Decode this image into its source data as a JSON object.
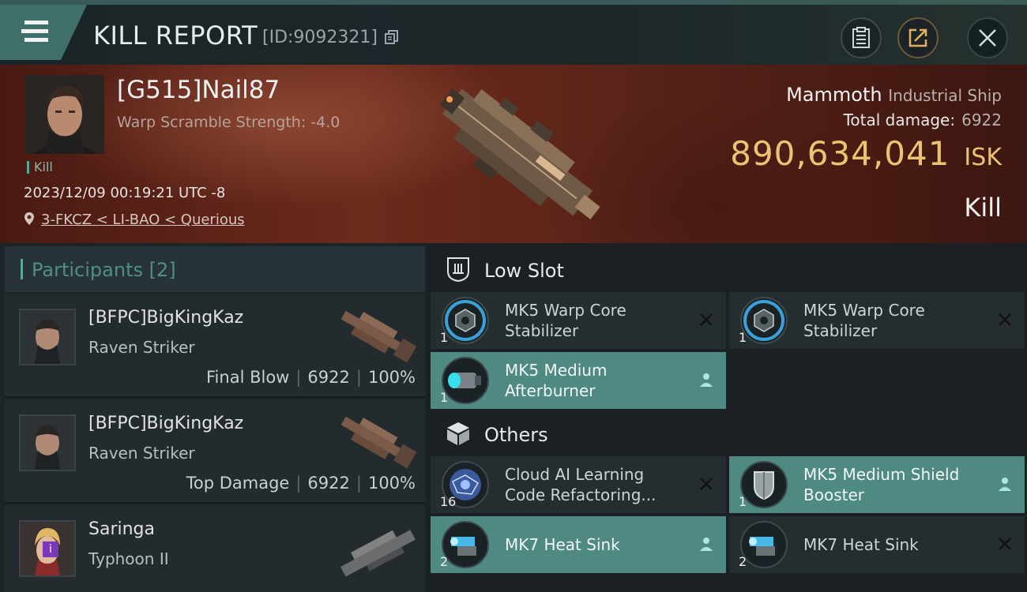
{
  "header": {
    "title": "KILL REPORT",
    "report_id": "[ID:9092321]",
    "icons": [
      "menu-icon",
      "copy-icon",
      "clipboard-icon",
      "share-icon",
      "close-icon"
    ]
  },
  "victim": {
    "name": "[G515]Nail87",
    "warp_scramble": "Warp Scramble Strength: -4.0",
    "tag": "Kill",
    "timestamp": "2023/12/09 00:19:21 UTC -8",
    "location": "3-FKCZ < LI-BAO < Querious"
  },
  "ship": {
    "name": "Mammoth",
    "class": "Industrial Ship",
    "total_damage_label": "Total damage:",
    "total_damage": "6922",
    "isk_value": "890,634,041",
    "isk_unit": "ISK",
    "result": "Kill"
  },
  "participants": {
    "title": "Participants [2]",
    "items": [
      {
        "name": "[BFPC]BigKingKaz",
        "ship": "Raven Striker",
        "role": "Final Blow",
        "damage": "6922",
        "percent": "100%"
      },
      {
        "name": "[BFPC]BigKingKaz",
        "ship": "Raven Striker",
        "role": "Top Damage",
        "damage": "6922",
        "percent": "100%"
      },
      {
        "name": "Saringa",
        "ship": "Typhoon II",
        "badge": "i"
      }
    ]
  },
  "low_slot": {
    "title": "Low Slot",
    "items": [
      {
        "name": "MK5 Warp Core Stabilizer",
        "qty": "1",
        "state": "destroyed"
      },
      {
        "name": "MK5 Warp Core Stabilizer",
        "qty": "1",
        "state": "destroyed"
      },
      {
        "name": "MK5 Medium Afterburner",
        "qty": "1",
        "state": "dropped"
      }
    ]
  },
  "others": {
    "title": "Others",
    "items": [
      {
        "name": "Cloud AI Learning Code Refactoring...",
        "qty": "16",
        "state": "destroyed"
      },
      {
        "name": "MK5 Medium Shield Booster",
        "qty": "1",
        "state": "dropped"
      },
      {
        "name": "MK7 Heat Sink",
        "qty": "2",
        "state": "dropped"
      },
      {
        "name": "MK7 Heat Sink",
        "qty": "2",
        "state": "destroyed"
      }
    ]
  },
  "colors": {
    "accent": "#4e8a82",
    "isk": "#ebc371",
    "background": "#1a2023"
  }
}
